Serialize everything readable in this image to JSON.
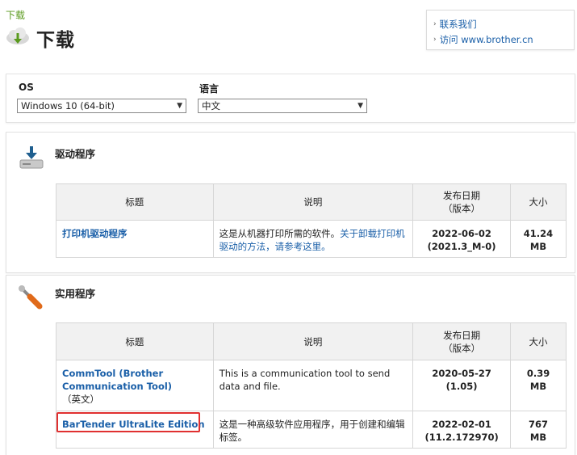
{
  "breadcrumb": "下载",
  "page_title": "下载",
  "links": [
    {
      "label": "联系我们"
    },
    {
      "label": "访问 www.brother.cn"
    }
  ],
  "filters": {
    "os_label": "OS",
    "os_value": "Windows 10 (64-bit)",
    "lang_label": "语言",
    "lang_value": "中文"
  },
  "table_headers": {
    "title": "标题",
    "desc": "说明",
    "date_line1": "发布日期",
    "date_line2": "（版本）",
    "size": "大小"
  },
  "sections": [
    {
      "heading": "驱动程序",
      "icon": "download-drive-icon",
      "rows": [
        {
          "name": "打印机驱动程序",
          "desc_text": "这是从机器打印所需的软件。",
          "desc_link": "关于卸载打印机驱动的方法，请参考这里。",
          "date": "2022-06-02",
          "version": "(2021.3_M-0)",
          "size_line1": "41.24",
          "size_line2": "MB"
        }
      ]
    },
    {
      "heading": "实用程序",
      "icon": "wrench-icon",
      "rows": [
        {
          "name": "CommTool (Brother Communication Tool)",
          "name_suffix": "（英文）",
          "desc_text": "This is a communication tool to send data and file.",
          "date": "2020-05-27",
          "version": "(1.05)",
          "size_line1": "0.39",
          "size_line2": "MB"
        },
        {
          "name": "BarTender UltraLite Edition",
          "desc_text": "这是一种高级软件应用程序，用于创建和编辑标签。",
          "date": "2022-02-01",
          "version": "(11.2.172970)",
          "size_line1": "767",
          "size_line2": "MB"
        }
      ]
    }
  ],
  "colors": {
    "link": "#1a5fa8",
    "breadcrumb": "#5a9a1e",
    "header_bg": "#f1f1f1",
    "highlight": "#e03030"
  }
}
